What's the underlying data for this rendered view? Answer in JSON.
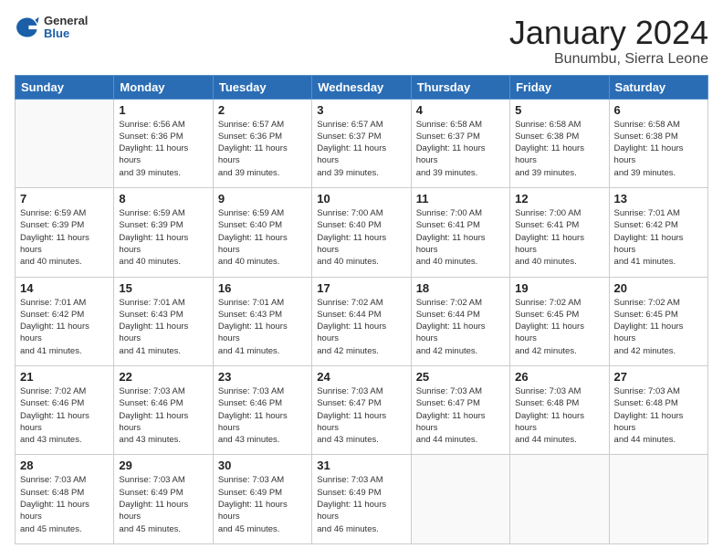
{
  "header": {
    "logo": {
      "general": "General",
      "blue": "Blue"
    },
    "title": "January 2024",
    "location": "Bunumbu, Sierra Leone"
  },
  "days_of_week": [
    "Sunday",
    "Monday",
    "Tuesday",
    "Wednesday",
    "Thursday",
    "Friday",
    "Saturday"
  ],
  "weeks": [
    [
      {
        "day": null
      },
      {
        "day": 1,
        "sunrise": "6:56 AM",
        "sunset": "6:36 PM",
        "daylight": "11 hours and 39 minutes."
      },
      {
        "day": 2,
        "sunrise": "6:57 AM",
        "sunset": "6:36 PM",
        "daylight": "11 hours and 39 minutes."
      },
      {
        "day": 3,
        "sunrise": "6:57 AM",
        "sunset": "6:37 PM",
        "daylight": "11 hours and 39 minutes."
      },
      {
        "day": 4,
        "sunrise": "6:58 AM",
        "sunset": "6:37 PM",
        "daylight": "11 hours and 39 minutes."
      },
      {
        "day": 5,
        "sunrise": "6:58 AM",
        "sunset": "6:38 PM",
        "daylight": "11 hours and 39 minutes."
      },
      {
        "day": 6,
        "sunrise": "6:58 AM",
        "sunset": "6:38 PM",
        "daylight": "11 hours and 39 minutes."
      }
    ],
    [
      {
        "day": 7,
        "sunrise": "6:59 AM",
        "sunset": "6:39 PM",
        "daylight": "11 hours and 40 minutes."
      },
      {
        "day": 8,
        "sunrise": "6:59 AM",
        "sunset": "6:39 PM",
        "daylight": "11 hours and 40 minutes."
      },
      {
        "day": 9,
        "sunrise": "6:59 AM",
        "sunset": "6:40 PM",
        "daylight": "11 hours and 40 minutes."
      },
      {
        "day": 10,
        "sunrise": "7:00 AM",
        "sunset": "6:40 PM",
        "daylight": "11 hours and 40 minutes."
      },
      {
        "day": 11,
        "sunrise": "7:00 AM",
        "sunset": "6:41 PM",
        "daylight": "11 hours and 40 minutes."
      },
      {
        "day": 12,
        "sunrise": "7:00 AM",
        "sunset": "6:41 PM",
        "daylight": "11 hours and 40 minutes."
      },
      {
        "day": 13,
        "sunrise": "7:01 AM",
        "sunset": "6:42 PM",
        "daylight": "11 hours and 41 minutes."
      }
    ],
    [
      {
        "day": 14,
        "sunrise": "7:01 AM",
        "sunset": "6:42 PM",
        "daylight": "11 hours and 41 minutes."
      },
      {
        "day": 15,
        "sunrise": "7:01 AM",
        "sunset": "6:43 PM",
        "daylight": "11 hours and 41 minutes."
      },
      {
        "day": 16,
        "sunrise": "7:01 AM",
        "sunset": "6:43 PM",
        "daylight": "11 hours and 41 minutes."
      },
      {
        "day": 17,
        "sunrise": "7:02 AM",
        "sunset": "6:44 PM",
        "daylight": "11 hours and 42 minutes."
      },
      {
        "day": 18,
        "sunrise": "7:02 AM",
        "sunset": "6:44 PM",
        "daylight": "11 hours and 42 minutes."
      },
      {
        "day": 19,
        "sunrise": "7:02 AM",
        "sunset": "6:45 PM",
        "daylight": "11 hours and 42 minutes."
      },
      {
        "day": 20,
        "sunrise": "7:02 AM",
        "sunset": "6:45 PM",
        "daylight": "11 hours and 42 minutes."
      }
    ],
    [
      {
        "day": 21,
        "sunrise": "7:02 AM",
        "sunset": "6:46 PM",
        "daylight": "11 hours and 43 minutes."
      },
      {
        "day": 22,
        "sunrise": "7:03 AM",
        "sunset": "6:46 PM",
        "daylight": "11 hours and 43 minutes."
      },
      {
        "day": 23,
        "sunrise": "7:03 AM",
        "sunset": "6:46 PM",
        "daylight": "11 hours and 43 minutes."
      },
      {
        "day": 24,
        "sunrise": "7:03 AM",
        "sunset": "6:47 PM",
        "daylight": "11 hours and 43 minutes."
      },
      {
        "day": 25,
        "sunrise": "7:03 AM",
        "sunset": "6:47 PM",
        "daylight": "11 hours and 44 minutes."
      },
      {
        "day": 26,
        "sunrise": "7:03 AM",
        "sunset": "6:48 PM",
        "daylight": "11 hours and 44 minutes."
      },
      {
        "day": 27,
        "sunrise": "7:03 AM",
        "sunset": "6:48 PM",
        "daylight": "11 hours and 44 minutes."
      }
    ],
    [
      {
        "day": 28,
        "sunrise": "7:03 AM",
        "sunset": "6:48 PM",
        "daylight": "11 hours and 45 minutes."
      },
      {
        "day": 29,
        "sunrise": "7:03 AM",
        "sunset": "6:49 PM",
        "daylight": "11 hours and 45 minutes."
      },
      {
        "day": 30,
        "sunrise": "7:03 AM",
        "sunset": "6:49 PM",
        "daylight": "11 hours and 45 minutes."
      },
      {
        "day": 31,
        "sunrise": "7:03 AM",
        "sunset": "6:49 PM",
        "daylight": "11 hours and 46 minutes."
      },
      {
        "day": null
      },
      {
        "day": null
      },
      {
        "day": null
      }
    ]
  ]
}
